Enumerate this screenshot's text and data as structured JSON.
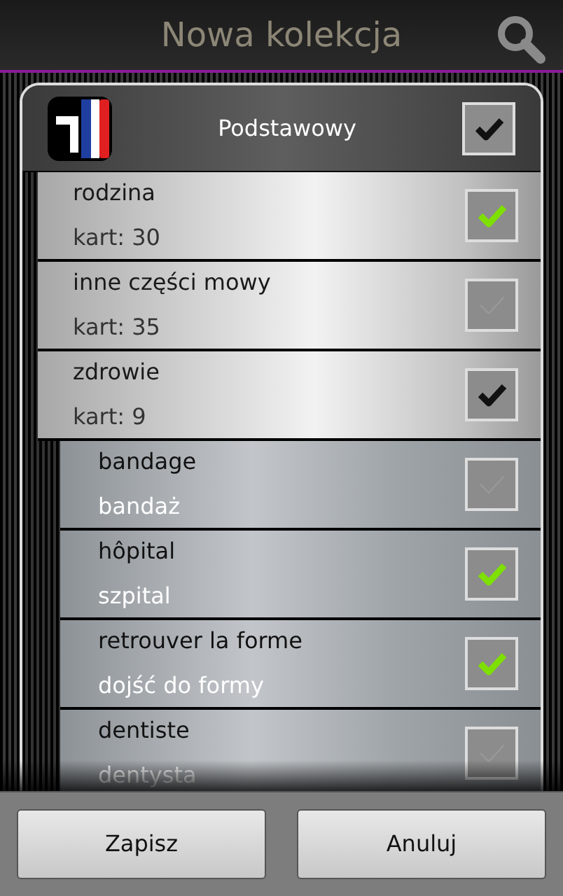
{
  "title_bar": {
    "title": "Nowa kolekcja"
  },
  "collection": {
    "name": "Podstawowy",
    "checked": true,
    "color": "#111111"
  },
  "categories": [
    {
      "name": "rodzina",
      "count": "kart: 30",
      "checked": true,
      "color": "#7ee000"
    },
    {
      "name": "inne części mowy",
      "count": "kart: 35",
      "checked": false
    },
    {
      "name": "zdrowie",
      "count": "kart: 9",
      "checked": true,
      "color": "#111111",
      "children": [
        {
          "word": "bandage",
          "translation": "bandaż",
          "checked": false
        },
        {
          "word": "hôpital",
          "translation": "szpital",
          "checked": true,
          "color": "#7ee000"
        },
        {
          "word": "retrouver la forme",
          "translation": "dojść do formy",
          "checked": true,
          "color": "#7ee000"
        },
        {
          "word": "dentiste",
          "translation": "dentysta",
          "checked": false
        }
      ]
    }
  ],
  "buttons": [
    {
      "label": "Zapisz"
    },
    {
      "label": "Anuluj"
    }
  ]
}
